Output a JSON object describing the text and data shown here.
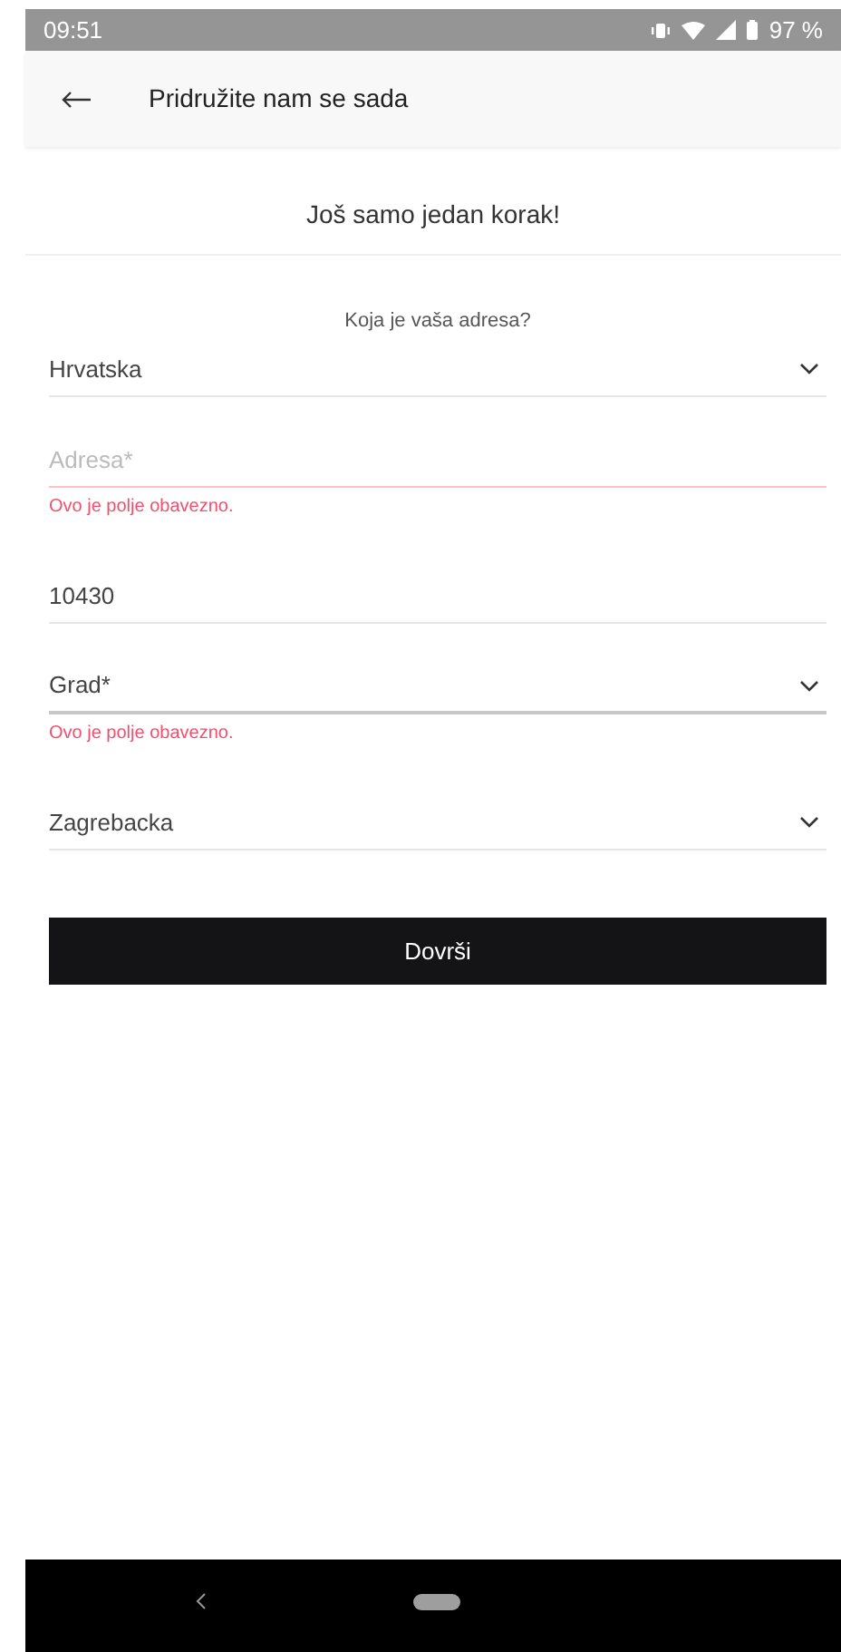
{
  "status_bar": {
    "time": "09:51",
    "battery": "97 %"
  },
  "header": {
    "title": "Pridružite nam se sada"
  },
  "subtitle": "Još samo jedan korak!",
  "question": "Koja je vaša adresa?",
  "fields": [
    {
      "kind": "select",
      "value": "Hrvatska"
    },
    {
      "kind": "input",
      "placeholder": "Adresa*",
      "error": "Ovo je polje obavezno."
    },
    {
      "kind": "input",
      "value": "10430"
    },
    {
      "kind": "select",
      "value": "Grad*",
      "error": "Ovo je polje obavezno."
    },
    {
      "kind": "select",
      "value": "Zagrebacka"
    }
  ],
  "submit": "Dovrši"
}
